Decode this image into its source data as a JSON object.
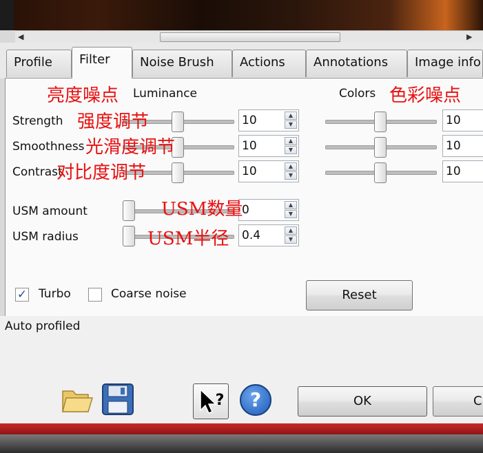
{
  "tabs": [
    "Profile",
    "Filter",
    "Noise Brush",
    "Actions",
    "Annotations",
    "Image info"
  ],
  "active_tab": "Filter",
  "sections": {
    "luminance_title": "Luminance",
    "colors_title": "Colors",
    "luminance_cn": "亮度噪点",
    "colors_cn": "色彩噪点"
  },
  "luminance_rows": [
    {
      "label": "Strength",
      "value": "10",
      "cn": "强度调节",
      "level": 0.5
    },
    {
      "label": "Smoothness",
      "value": "10",
      "cn": "光滑度调节",
      "level": 0.5
    },
    {
      "label": "Contrast",
      "value": "10",
      "cn": "对比度调节",
      "level": 0.5
    }
  ],
  "color_rows": [
    {
      "value": "10",
      "level": 0.5
    },
    {
      "value": "10",
      "level": 0.5
    },
    {
      "value": "10",
      "level": 0.5
    }
  ],
  "usm_rows": [
    {
      "label": "USM amount",
      "value": "0",
      "cn": "USM数量",
      "level": 0
    },
    {
      "label": "USM radius",
      "value": "0.4",
      "cn": "USM半径",
      "level": 0
    }
  ],
  "options": {
    "turbo_label": "Turbo",
    "turbo_checked": true,
    "coarse_label": "Coarse noise",
    "coarse_checked": false,
    "reset_label": "Reset"
  },
  "status_text": "Auto profiled",
  "buttons": {
    "ok_label": "OK",
    "cancel_partial": "C"
  },
  "icons": {
    "check": "✓",
    "scroll_left": "◀",
    "scroll_right": "▶",
    "spin_up": "▲",
    "spin_down": "▼",
    "help_question": "?"
  }
}
